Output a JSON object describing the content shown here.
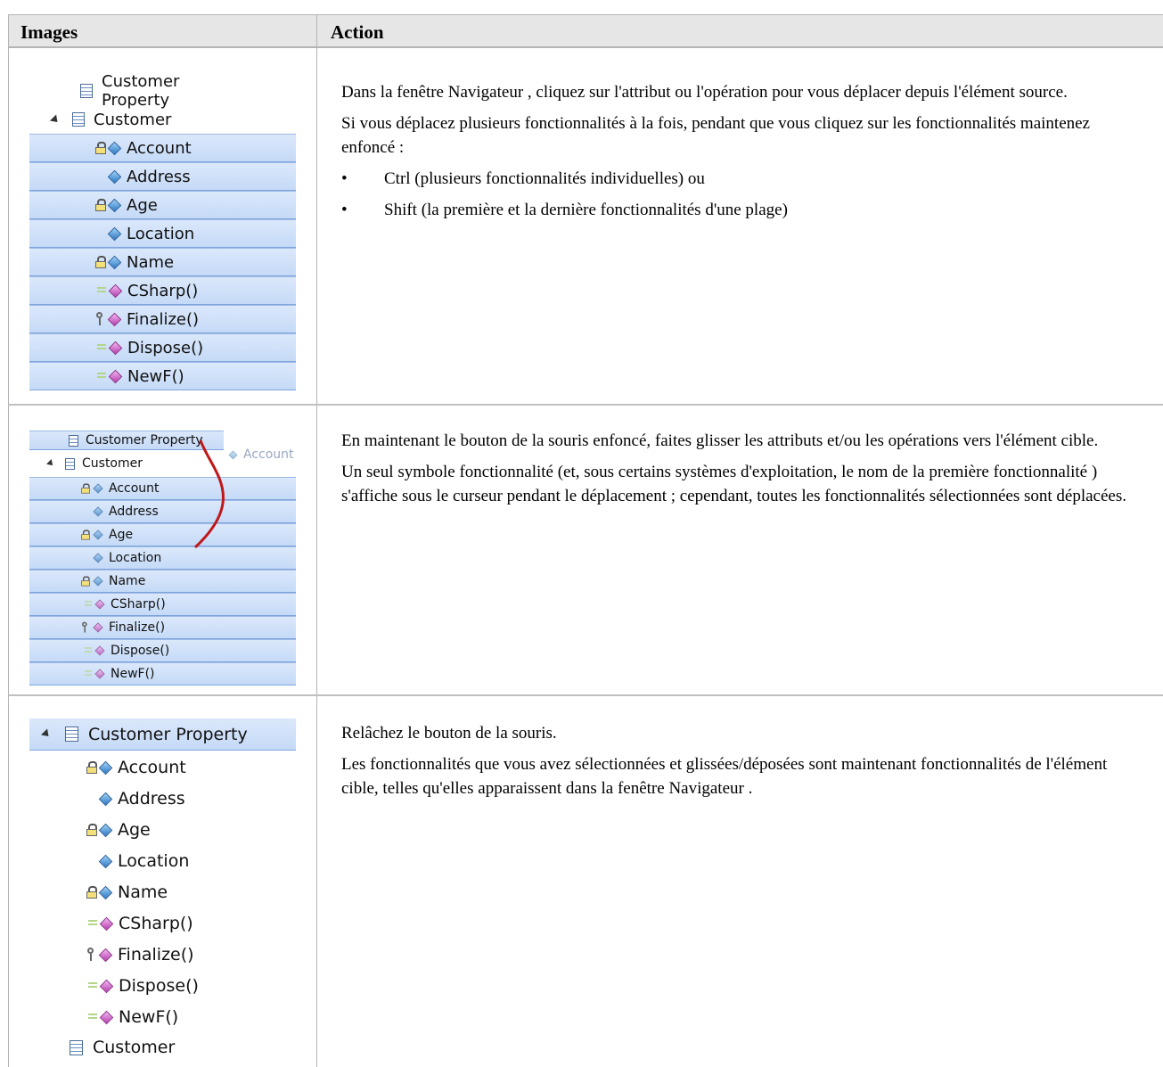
{
  "header": {
    "images": "Images",
    "action": "Action"
  },
  "row1": {
    "tree": {
      "parent_label": "Customer Property",
      "source_label": "Customer",
      "features": [
        "Account",
        "Address",
        "Age",
        "Location",
        "Name",
        "CSharp()",
        "Finalize()",
        "Dispose()",
        "NewF()"
      ]
    },
    "p1": "Dans la fenêtre Navigateur , cliquez sur l'attribut ou l'opération pour vous déplacer depuis l'élément source.",
    "p2": "Si vous déplacez plusieurs fonctionnalités à la fois, pendant que vous cliquez sur les fonctionnalités maintenez enfoncé :",
    "bullets": [
      "Ctrl (plusieurs fonctionnalités individuelles) ou",
      "Shift (la première et la dernière fonctionnalités d'une plage)"
    ]
  },
  "row2": {
    "tree": {
      "parent_label": "Customer Property",
      "source_label": "Customer",
      "drag_label": "Account",
      "features": [
        "Account",
        "Address",
        "Age",
        "Location",
        "Name",
        "CSharp()",
        "Finalize()",
        "Dispose()",
        "NewF()"
      ]
    },
    "p1": "En maintenant le bouton de la souris enfoncé, faites glisser les attributs et/ou les opérations vers l'élément cible.",
    "p2": "Un seul symbole fonctionnalité (et, sous certains systèmes d'exploitation, le nom de la première fonctionnalité ) s'affiche sous le curseur pendant le déplacement ; cependant, toutes les fonctionnalités sélectionnées sont déplacées."
  },
  "row3": {
    "tree": {
      "target_label": "Customer Property",
      "features": [
        "Account",
        "Address",
        "Age",
        "Location",
        "Name",
        "CSharp()",
        "Finalize()",
        "Dispose()",
        "NewF()"
      ],
      "other_label": "Customer"
    },
    "p1": "Relâchez le bouton de la souris.",
    "p2": "Les fonctionnalités que vous avez sélectionnées et glissées/déposées sont maintenant fonctionnalités de l'élément cible, telles qu'elles apparaissent dans la fenêtre Navigateur ."
  },
  "colors": {
    "header_bg": "#e6e6e6",
    "selection": "#c5daf7",
    "drag_curve": "#c01818"
  },
  "icons": [
    "class-icon",
    "expand-triangle-icon",
    "lock-icon",
    "key-icon",
    "attribute-diamond-icon",
    "operation-diamond-icon"
  ]
}
